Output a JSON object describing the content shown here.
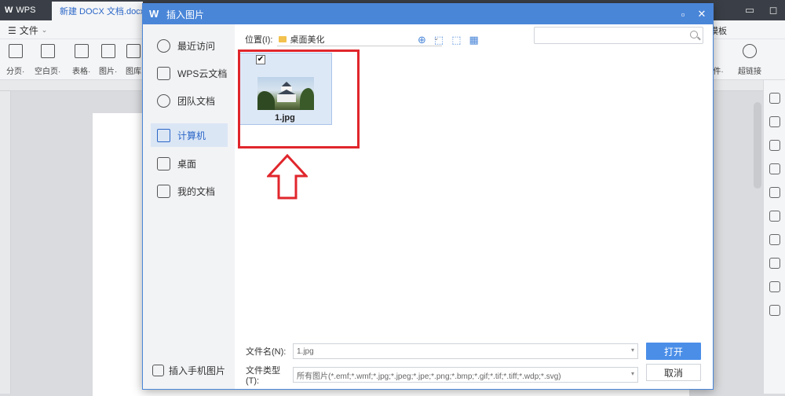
{
  "app": {
    "wps_tab": "WPS",
    "doc_tab": "新建 DOCX 文档.docx",
    "file_menu": "文件",
    "toolbar": [
      {
        "label": "分页·",
        "icon": "page-break-icon"
      },
      {
        "label": "空白页·",
        "icon": "blank-page-icon"
      },
      {
        "label": "表格·",
        "icon": "table-icon"
      },
      {
        "label": "图片·",
        "icon": "picture-icon"
      },
      {
        "label": "图库",
        "icon": "gallery-icon"
      }
    ],
    "right_toolbar": [
      {
        "label": "模板",
        "icon": "template-icon"
      },
      {
        "label": "件·",
        "icon": "attachment-icon"
      },
      {
        "label": "超链接",
        "icon": "hyperlink-icon"
      }
    ]
  },
  "dialog": {
    "title": "插入图片",
    "sidebar": [
      {
        "label": "最近访问",
        "icon": "clock-icon",
        "active": false
      },
      {
        "label": "WPS云文档",
        "icon": "cloud-doc-icon",
        "active": false
      },
      {
        "label": "团队文档",
        "icon": "team-icon",
        "active": false
      },
      {
        "label": "计算机",
        "icon": "computer-icon",
        "active": true
      },
      {
        "label": "桌面",
        "icon": "desktop-icon",
        "active": false
      },
      {
        "label": "我的文档",
        "icon": "my-docs-icon",
        "active": false
      }
    ],
    "sidebar_bottom": "插入手机图片",
    "location_label": "位置(I):",
    "location_value": "桌面美化",
    "search_placeholder": "",
    "files": [
      {
        "name": "1.jpg",
        "checked": true
      }
    ],
    "filename_label": "文件名(N):",
    "filename_value": "1.jpg",
    "filetype_label": "文件类型(T):",
    "filetype_value": "所有图片(*.emf;*.wmf;*.jpg;*.jpeg;*.jpe;*.png;*.bmp;*.gif;*.tif;*.tiff;*.wdp;*.svg)",
    "open_button": "打开",
    "cancel_button": "取消"
  },
  "colors": {
    "accent": "#4a86d8",
    "highlight": "#e0262c"
  }
}
